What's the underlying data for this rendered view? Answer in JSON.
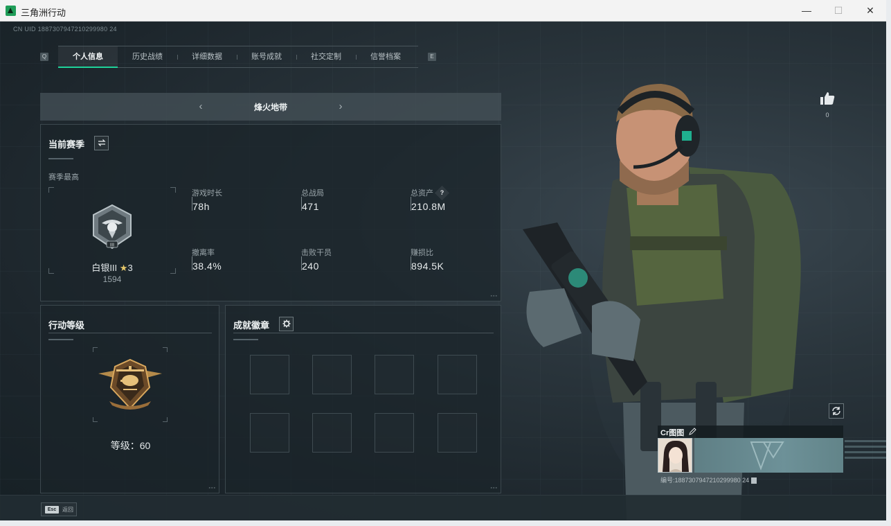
{
  "window": {
    "title": "三角洲行动",
    "minimize_glyph": "—",
    "maximize_glyph": "☐",
    "close_glyph": "✕"
  },
  "header": {
    "uid_text": "CN UID 1887307947210299980 24"
  },
  "tabs": {
    "key_left": "Q",
    "key_right": "E",
    "items": [
      {
        "label": "个人信息",
        "active": true
      },
      {
        "label": "历史战绩",
        "active": false
      },
      {
        "label": "详细数据",
        "active": false
      },
      {
        "label": "账号成就",
        "active": false
      },
      {
        "label": "社交定制",
        "active": false
      },
      {
        "label": "信誉档案",
        "active": false
      }
    ]
  },
  "mode_selector": {
    "prev_glyph": "‹",
    "next_glyph": "›",
    "current": "烽火地带"
  },
  "season_panel": {
    "title": "当前赛季",
    "swap_icon": "swap-arrows-icon",
    "best_label": "赛季最高",
    "rank_name": "白银III",
    "rank_star_glyph": "★",
    "rank_stars": "3",
    "rank_points": "1594",
    "stats": [
      {
        "label": "游戏时长",
        "value": "78h"
      },
      {
        "label": "总战局",
        "value": "471"
      },
      {
        "label": "总资产",
        "value": "210.8M",
        "help": "?"
      },
      {
        "label": "撤离率",
        "value": "38.4%"
      },
      {
        "label": "击败干员",
        "value": "240"
      },
      {
        "label": "赚损比",
        "value": "894.5K"
      }
    ]
  },
  "action_panel": {
    "title": "行动等级",
    "level_text": "等级：60"
  },
  "badges_panel": {
    "title": "成就徽章",
    "settings_icon": "gear-icon",
    "slot_count": 8
  },
  "like": {
    "icon": "thumbs-up-icon",
    "count": "0"
  },
  "player_card": {
    "name": "Cr图图",
    "edit_icon": "pencil-icon",
    "uid_text": "编号:1887307947210299980 24",
    "copy_icon": "copy-icon"
  },
  "refresh_icon": "refresh-icon",
  "bottom_bar": {
    "esc_key": "Esc",
    "esc_label": "返回"
  },
  "colors": {
    "accent": "#1fd39a",
    "panel_bg": "#1a242a",
    "text_primary": "#e8eced",
    "text_secondary": "#9aa5aa"
  }
}
